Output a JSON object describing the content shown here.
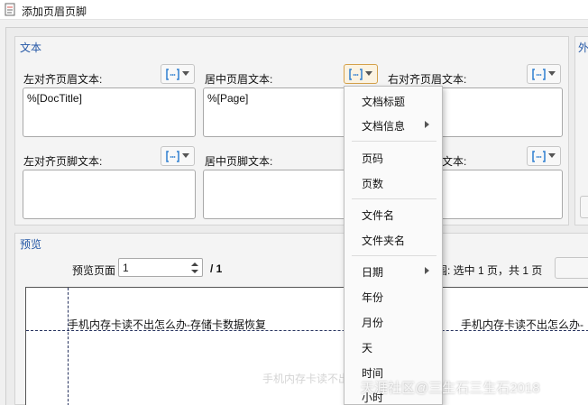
{
  "window": {
    "title": "添加页眉页脚"
  },
  "text_section": {
    "label": "文本",
    "header_left": {
      "label": "左对齐页眉文本:",
      "value": "%[DocTitle]"
    },
    "header_center": {
      "label": "居中页眉文本:",
      "value": "%[Page]"
    },
    "header_right": {
      "label": "右对齐页眉文本:",
      "value": "%[...]"
    },
    "footer_left": {
      "label": "左对齐页脚文本:",
      "value": ""
    },
    "footer_center": {
      "label": "居中页脚文本:",
      "value": ""
    },
    "footer_right": {
      "label": "右对齐页脚文本:",
      "value": ""
    }
  },
  "right_section": {
    "label": "外"
  },
  "preview_section": {
    "label": "预览",
    "page_label": "预览页面",
    "page_value": "1",
    "page_total": "/ 1",
    "range_text": "围: 选中 1 页，共 1 页",
    "header_text": "手机内存卡读不出怎么办-存储卡数据恢复",
    "header_text_right": "手机内存卡读不出怎么办-",
    "faint_text": "手机内存卡读不出怎么办-存储卡数据"
  },
  "macro_menu": {
    "items": [
      {
        "label": "文档标题",
        "submenu": false
      },
      {
        "label": "文档信息",
        "submenu": true
      },
      {
        "label": "页码",
        "submenu": false
      },
      {
        "label": "页数",
        "submenu": false
      },
      {
        "label": "文件名",
        "submenu": false
      },
      {
        "label": "文件夹名",
        "submenu": false
      },
      {
        "label": "日期",
        "submenu": true
      },
      {
        "label": "年份",
        "submenu": false
      },
      {
        "label": "月份",
        "submenu": false
      },
      {
        "label": "天",
        "submenu": false
      },
      {
        "label": "时间",
        "submenu": false
      },
      {
        "label": "小时",
        "submenu": false
      }
    ]
  },
  "icons": {
    "app": "document-icon",
    "macro": "macro-bracket-icon"
  },
  "colors": {
    "section_label": "#2457a6",
    "macro_icon": "#2f7fd0",
    "active_button_border": "#d4a14a"
  },
  "watermark": "天涯社区@三生石三生石2018"
}
